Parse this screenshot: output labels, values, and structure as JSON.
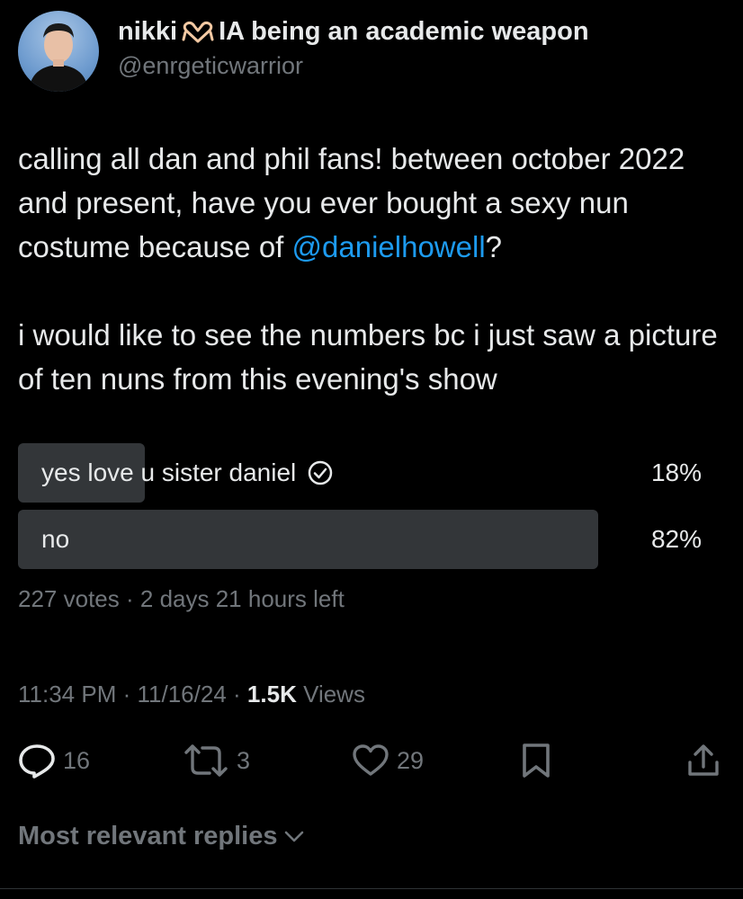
{
  "author": {
    "display_name_prefix": "nikki",
    "display_name_suffix": "IA being an academic weapon",
    "handle": "@enrgeticwarrior"
  },
  "tweet": {
    "text_part1": "calling all dan and phil fans! between october 2022 and present, have you ever bought a sexy nun costume because of ",
    "mention": "@danielhowell",
    "text_part2": "?",
    "paragraph2": "i would like to see the numbers bc i just saw a picture of ten nuns from this evening's show"
  },
  "poll": {
    "options": [
      {
        "label": "yes love u sister daniel",
        "percent_text": "18%",
        "percent": 18,
        "voted": true
      },
      {
        "label": "no",
        "percent_text": "82%",
        "percent": 82,
        "voted": false
      }
    ],
    "votes": "227 votes",
    "separator": "·",
    "time_left": "2 days 21 hours left"
  },
  "meta": {
    "time": "11:34 PM",
    "date": "11/16/24",
    "separator": "·",
    "views_count": "1.5K",
    "views_label": "Views"
  },
  "actions": {
    "replies": "16",
    "reposts": "3",
    "likes": "29"
  },
  "replies_sort": {
    "label": "Most relevant replies"
  },
  "colors": {
    "background": "#000000",
    "text": "#e7e9ea",
    "secondary": "#71767b",
    "mention": "#1d9bf0",
    "poll_bar": "#333639"
  },
  "icons": {
    "name_emoji": "heart-hands-icon",
    "voted": "check-circle-icon",
    "reply": "reply-icon",
    "repost": "repost-icon",
    "like": "heart-icon",
    "bookmark": "bookmark-icon",
    "share": "share-icon",
    "sort": "chevron-down-icon"
  }
}
